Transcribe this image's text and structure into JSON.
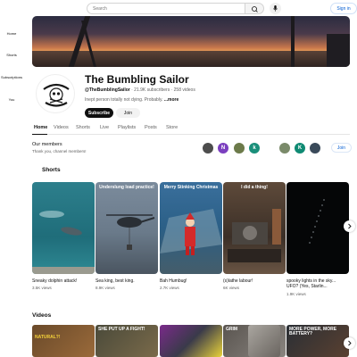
{
  "topbar": {
    "search_placeholder": "Search",
    "signin_label": "Sign in"
  },
  "sidenav": {
    "items": [
      {
        "label": "Home"
      },
      {
        "label": "Shorts"
      },
      {
        "label": "Subscriptions"
      },
      {
        "label": "You"
      }
    ]
  },
  "channel": {
    "title": "The Bumbling Sailor",
    "handle": "@TheBumblingSailor",
    "subscribers": "21.9K subscribers",
    "video_count": "258 videos",
    "description": "Inept person totally not dying. Probably. ",
    "more_label": "...more",
    "subscribe_label": "Subscribe",
    "join_label": "Join",
    "avatar_text": "BUMBLING SAILOR"
  },
  "tabs": [
    {
      "label": "Home",
      "active": true
    },
    {
      "label": "Videos"
    },
    {
      "label": "Shorts"
    },
    {
      "label": "Live"
    },
    {
      "label": "Playlists"
    },
    {
      "label": "Posts"
    },
    {
      "label": "Store"
    }
  ],
  "members": {
    "title": "Our members",
    "subtitle": "Thank you, channel members!",
    "join_label": "Join",
    "avatars": [
      {
        "initial": "",
        "color": "#4d4d4d"
      },
      {
        "initial": "N",
        "color": "#7b3fbf"
      },
      {
        "initial": "",
        "color": "#6c7a4a"
      },
      {
        "initial": "k",
        "color": "#1a8f7a"
      },
      {
        "initial": "",
        "color": "#7a8a6a"
      },
      {
        "initial": "K",
        "color": "#0f8a73"
      },
      {
        "initial": "",
        "color": "#3a4a5a"
      }
    ]
  },
  "shorts": {
    "title": "Shorts",
    "items": [
      {
        "title": "Sneaky dolphin attack!",
        "views": "3.5K views",
        "overlay": ""
      },
      {
        "title": "Sea king, best king.",
        "views": "8.9K views",
        "overlay": "Underslung load practice!"
      },
      {
        "title": "Bah Humbug!",
        "views": "2.7K views",
        "overlay": "Merry Stinking Christmas"
      },
      {
        "title": "(s)lathe labour!",
        "views": "6K views",
        "overlay": "I did a thing!"
      },
      {
        "title": "spooky lights in the sky... UFO? (Yes, Starlin...",
        "views": "1.9K views",
        "overlay": ""
      }
    ]
  },
  "videos": {
    "title": "Videos",
    "items": [
      {
        "overlay": "NATURAL?!"
      },
      {
        "overlay": "SHE PUT UP A FIGHT!"
      },
      {
        "overlay": ""
      },
      {
        "overlay": "GRIM"
      },
      {
        "overlay": ""
      },
      {
        "overlay": "MORE POWER, MORE BATTERY?"
      }
    ]
  },
  "colors": {
    "accent_blue": "#065fd4",
    "text_primary": "#0f0f0f",
    "text_secondary": "#606060"
  }
}
